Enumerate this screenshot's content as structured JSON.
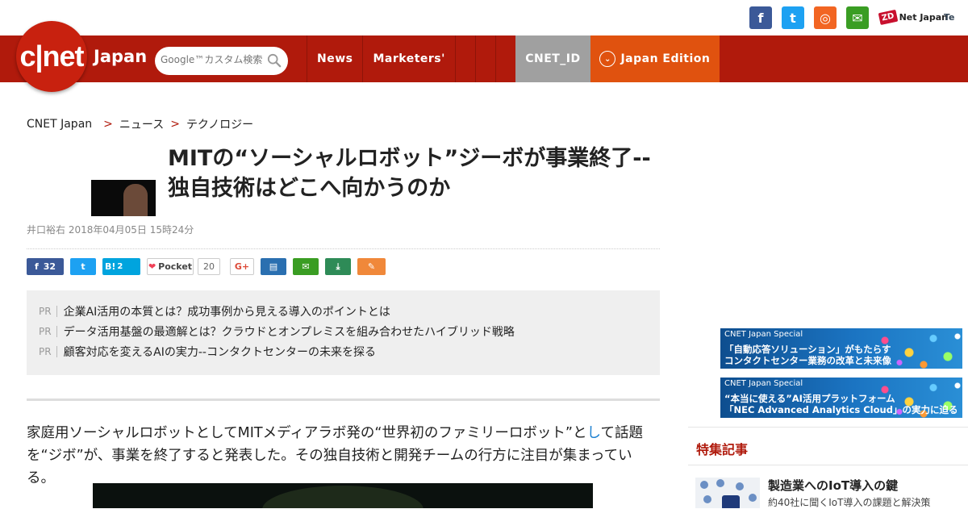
{
  "topbar": {
    "social": [
      {
        "name": "facebook",
        "glyph": "f",
        "color": "#3b5998"
      },
      {
        "name": "twitter",
        "glyph": "t",
        "color": "#1da1f2"
      },
      {
        "name": "rss",
        "glyph": "◎",
        "color": "#f26522"
      },
      {
        "name": "mail",
        "glyph": "✉",
        "color": "#3a9d23"
      }
    ],
    "zdnet_label": "Net Japan",
    "zdnet_mark": "ZD",
    "te_label": "Te"
  },
  "header": {
    "logo_text": "c|net",
    "logo_sub": "Japan",
    "search_placeholder": "Google™カスタム検索",
    "nav": {
      "news": "News",
      "marketers": "Marketers'",
      "cnet_id": "CNET_ID",
      "edition": "Japan Edition"
    }
  },
  "breadcrumb": {
    "items": [
      "CNET Japan",
      "ニュース",
      "テクノロジー"
    ],
    "separator": ">"
  },
  "article": {
    "title": "MITの“ソーシャルロボット”ジーボが事業終了--独自技術はどこへ向かうのか",
    "byline": "井口裕右 2018年04月05日 15時24分",
    "share": {
      "facebook_count": "32",
      "hatena_label": "B!",
      "hatena_count": "2",
      "pocket_label": "Pocket",
      "pocket_count": "20",
      "gplus_label": "G+"
    },
    "pr_label": "PR",
    "pr_links": [
      "企業AI活用の本質とは？成功事例から見える導入のポイントとは",
      "データ活用基盤の最適解とは？クラウドとオンプレミスを組み合わせたハイブリッド戦略",
      "顧客対応を変えるAIの実力--コンタクトセンターの未来を探る"
    ],
    "lead_before": "家庭用ソーシャルロボットとしてMITメディアラボ発の“世界初のファミリーロボット”と",
    "lead_highlight": "し",
    "lead_after": "て話題を“ジボ”が、事業を終了すると発表した。その独自技術と開発チームの行方に注目が集まっている。"
  },
  "sidebar": {
    "banners": [
      {
        "tag": "CNET Japan Special",
        "line1": "「自動応答ソリューション」がもたらす",
        "line2": "コンタクトセンター業務の改革と未来像"
      },
      {
        "tag": "CNET Japan Special",
        "line1": "“本当に使える”AI活用プラットフォーム",
        "line2": "「NEC Advanced Analytics Cloud」の実力に迫る"
      }
    ],
    "section_title": "特集記事",
    "feature": {
      "title": "製造業へのIoT導入の鍵",
      "desc": "約40社に聞くIoT導入の課題と解決策"
    }
  }
}
